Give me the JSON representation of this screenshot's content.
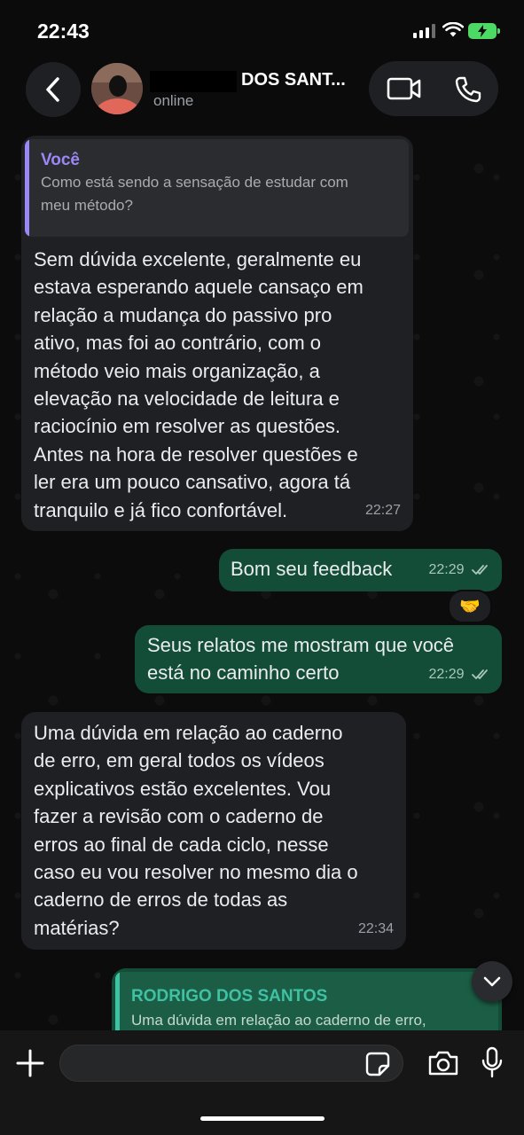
{
  "status_bar": {
    "time": "22:43"
  },
  "header": {
    "contact_name": "DOS SANT...",
    "contact_status": "online"
  },
  "messages": [
    {
      "direction": "incoming",
      "quote": {
        "author": "Você",
        "text": "Como está sendo a sensação de estudar com\nmeu método?"
      },
      "text": "Sem dúvida excelente, geralmente eu\nestava esperando aquele cansaço em\nrelação a mudança do passivo pro\nativo, mas foi ao contrário, com o\nmétodo veio mais organização, a\nelevação na velocidade de leitura e\nraciocínio em resolver as questões.\nAntes na hora de resolver questões e\nler era um pouco cansativo, agora tá\ntranquilo e já fico confortável.",
      "time": "22:27"
    },
    {
      "direction": "outgoing",
      "text": "Bom seu feedback",
      "time": "22:29",
      "reaction": "🤝"
    },
    {
      "direction": "outgoing",
      "text": "Seus relatos me mostram que você\nestá no caminho certo",
      "time": "22:29"
    },
    {
      "direction": "incoming",
      "text": "Uma dúvida em relação ao caderno\nde erro, em geral todos os vídeos\nexplicativos estão excelentes. Vou\nfazer a revisão com o caderno de\nerros ao final de cada ciclo, nesse\ncaso eu vou resolver no mesmo dia o\ncaderno de erros de todas as\nmatérias?",
      "time": "22:34"
    },
    {
      "direction": "outgoing",
      "quote": {
        "author": "RODRIGO DOS SANTOS",
        "text": "Uma dúvida em relação ao caderno de erro,"
      }
    }
  ],
  "input": {
    "placeholder": "",
    "value": ""
  },
  "colors": {
    "incoming_bubble": "#1f2023",
    "outgoing_bubble": "#144d37",
    "quote_self": "#9b87f5",
    "quote_contact": "#3fc1a4",
    "read_ticks": "#a8c8b9"
  },
  "icons": [
    "chevron-left-icon",
    "video-icon",
    "phone-icon",
    "plus-icon",
    "sticker-icon",
    "camera-icon",
    "microphone-icon",
    "chevron-down-icon",
    "double-check-icon"
  ]
}
